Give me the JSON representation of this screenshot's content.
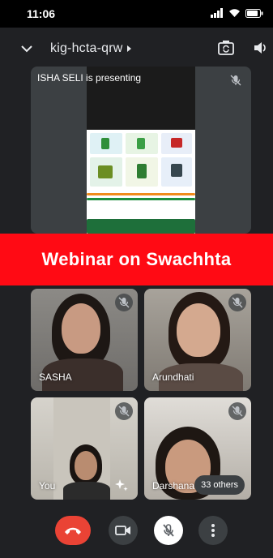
{
  "status_bar": {
    "time": "11:06"
  },
  "header": {
    "meeting_code": "kig-hcta-qrw",
    "icons": [
      "chevron-down-icon",
      "switch-camera-icon",
      "speaker-icon"
    ]
  },
  "presentation": {
    "label": "ISHA SELI is presenting",
    "mic_muted": true
  },
  "banner": {
    "text": "Webinar on Swachhta",
    "color": "#ff0a14"
  },
  "participants": [
    {
      "name": "SASHA",
      "mic_muted": true
    },
    {
      "name": "Arundhati",
      "mic_muted": true
    },
    {
      "name": "You",
      "mic_muted": true
    },
    {
      "name": "Darshana",
      "mic_muted": true
    }
  ],
  "others_count": "33 others",
  "controls": {
    "end_call_color": "#ea4335",
    "buttons": [
      "end-call-icon",
      "camera-icon",
      "mic-off-icon",
      "more-icon"
    ]
  }
}
